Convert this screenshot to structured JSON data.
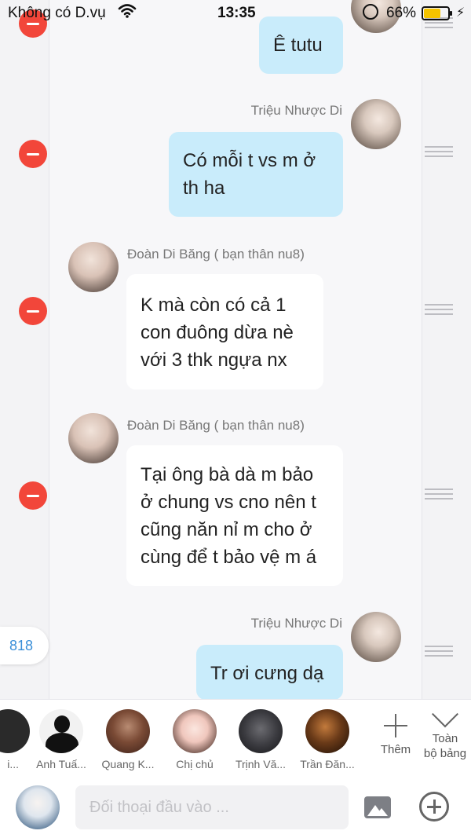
{
  "status_bar": {
    "carrier": "Không có D.vụ",
    "time": "13:35",
    "battery": "66%",
    "battery_level": 0.66
  },
  "messages": [
    {
      "direction": "outgoing",
      "sender": "",
      "lines": [
        "Ê tutu"
      ]
    },
    {
      "direction": "outgoing",
      "sender": "Triệu Nhược Di",
      "lines": [
        "Có mỗi t vs m ở",
        "th ha"
      ]
    },
    {
      "direction": "incoming",
      "sender": "Đoàn Di Băng ( bạn thân nu8)",
      "lines": [
        "K mà còn có cả 1",
        "con đuông dừa nè",
        "với 3 thk ngựa nx"
      ]
    },
    {
      "direction": "incoming",
      "sender": "Đoàn Di Băng ( bạn thân nu8)",
      "lines": [
        "Tại ông bà dà m bảo",
        "ở chung vs cno nên t",
        "cũng năn nỉ m cho ở",
        "cùng để t bảo vệ m á"
      ]
    },
    {
      "direction": "outgoing",
      "sender": "Triệu Nhược Di",
      "lines": [
        "Tr ơi cưng dạ"
      ]
    }
  ],
  "count_badge": "818",
  "contacts": [
    {
      "name": "i..."
    },
    {
      "name": "Anh Tuấ..."
    },
    {
      "name": "Quang K..."
    },
    {
      "name": "Chị chủ"
    },
    {
      "name": "Trịnh Vă..."
    },
    {
      "name": "Trần Đăn..."
    }
  ],
  "actions": {
    "add_label": "Thêm",
    "all_board_label_1": "Toàn",
    "all_board_label_2": "bộ bảng"
  },
  "input": {
    "placeholder": "Đối thoại đầu vào ..."
  },
  "colors": {
    "outgoing_bubble": "#c9ecfb",
    "incoming_bubble": "#ffffff",
    "remove_button": "#f2463a",
    "badge_text": "#3a8fd8"
  }
}
